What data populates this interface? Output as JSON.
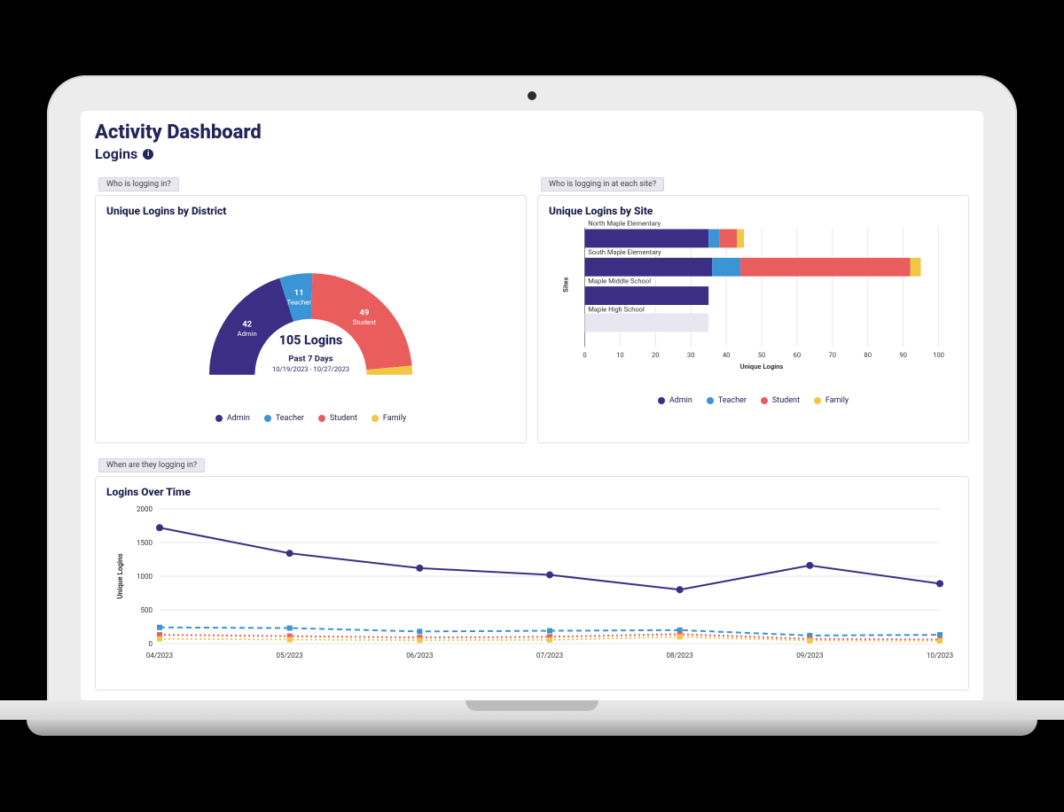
{
  "header": {
    "title": "Activity Dashboard",
    "subtitle": "Logins",
    "info_tooltip": "i"
  },
  "colors": {
    "admin": "#3d2e85",
    "teacher": "#3a94d6",
    "student": "#ea5d5d",
    "family": "#f2c744",
    "grid": "#e6e4ef",
    "text_dark": "#24235a"
  },
  "legend_labels": {
    "admin": "Admin",
    "teacher": "Teacher",
    "student": "Student",
    "family": "Family"
  },
  "panels": {
    "district": {
      "tag": "Who is logging in?",
      "title": "Unique Logins by District",
      "center_value": "105 Logins",
      "period": "Past 7 Days",
      "date_range": "10/19/2023 - 10/27/2023",
      "slice_admin_label": "42\nAdmin",
      "slice_teacher_label": "11\nTeacher",
      "slice_student_label": "49\nStudent"
    },
    "site": {
      "tag": "Who is logging in at each site?",
      "title": "Unique Logins by Site",
      "y_label": "Sites",
      "x_label": "Unique Logins"
    },
    "time": {
      "tag": "When are they logging in?",
      "title": "Logins Over Time",
      "y_label": "Unique Logins"
    }
  },
  "chart_data": [
    {
      "id": "district_donut",
      "type": "pie",
      "title": "Unique Logins by District",
      "subtitle": "Past 7 Days 10/19/2023 - 10/27/2023",
      "total_label": "105 Logins",
      "series": [
        {
          "name": "Admin",
          "value": 42
        },
        {
          "name": "Teacher",
          "value": 11
        },
        {
          "name": "Student",
          "value": 49
        },
        {
          "name": "Family",
          "value": 3
        }
      ],
      "note": "semi-donut (180°)"
    },
    {
      "id": "site_stacked_bar",
      "type": "bar",
      "orientation": "horizontal",
      "stacked": true,
      "title": "Unique Logins by Site",
      "xlabel": "Unique Logins",
      "ylabel": "Sites",
      "xlim": [
        0,
        100
      ],
      "categories": [
        "North Maple Elementary",
        "South Maple Elementary",
        "Maple Middle School",
        "Maple High School"
      ],
      "series": [
        {
          "name": "Admin",
          "values": [
            35,
            36,
            35,
            0
          ]
        },
        {
          "name": "Teacher",
          "values": [
            3,
            8,
            0,
            0
          ]
        },
        {
          "name": "Student",
          "values": [
            5,
            48,
            0,
            0
          ]
        },
        {
          "name": "Family",
          "values": [
            2,
            3,
            0,
            0
          ]
        }
      ]
    },
    {
      "id": "logins_over_time",
      "type": "line",
      "title": "Logins Over Time",
      "xlabel": "",
      "ylabel": "Unique Logins",
      "ylim": [
        0,
        2000
      ],
      "x": [
        "04/2023",
        "05/2023",
        "06/2023",
        "07/2023",
        "08/2023",
        "09/2023",
        "10/2023"
      ],
      "series": [
        {
          "name": "Admin",
          "values": [
            1720,
            1340,
            1120,
            1020,
            800,
            1160,
            890
          ],
          "style": "solid"
        },
        {
          "name": "Teacher",
          "values": [
            240,
            230,
            180,
            190,
            200,
            120,
            130
          ],
          "style": "dashed"
        },
        {
          "name": "Student",
          "values": [
            130,
            110,
            90,
            100,
            140,
            70,
            60
          ],
          "style": "dotted"
        },
        {
          "name": "Family",
          "values": [
            70,
            60,
            50,
            55,
            100,
            45,
            40
          ],
          "style": "dotted"
        }
      ]
    }
  ]
}
